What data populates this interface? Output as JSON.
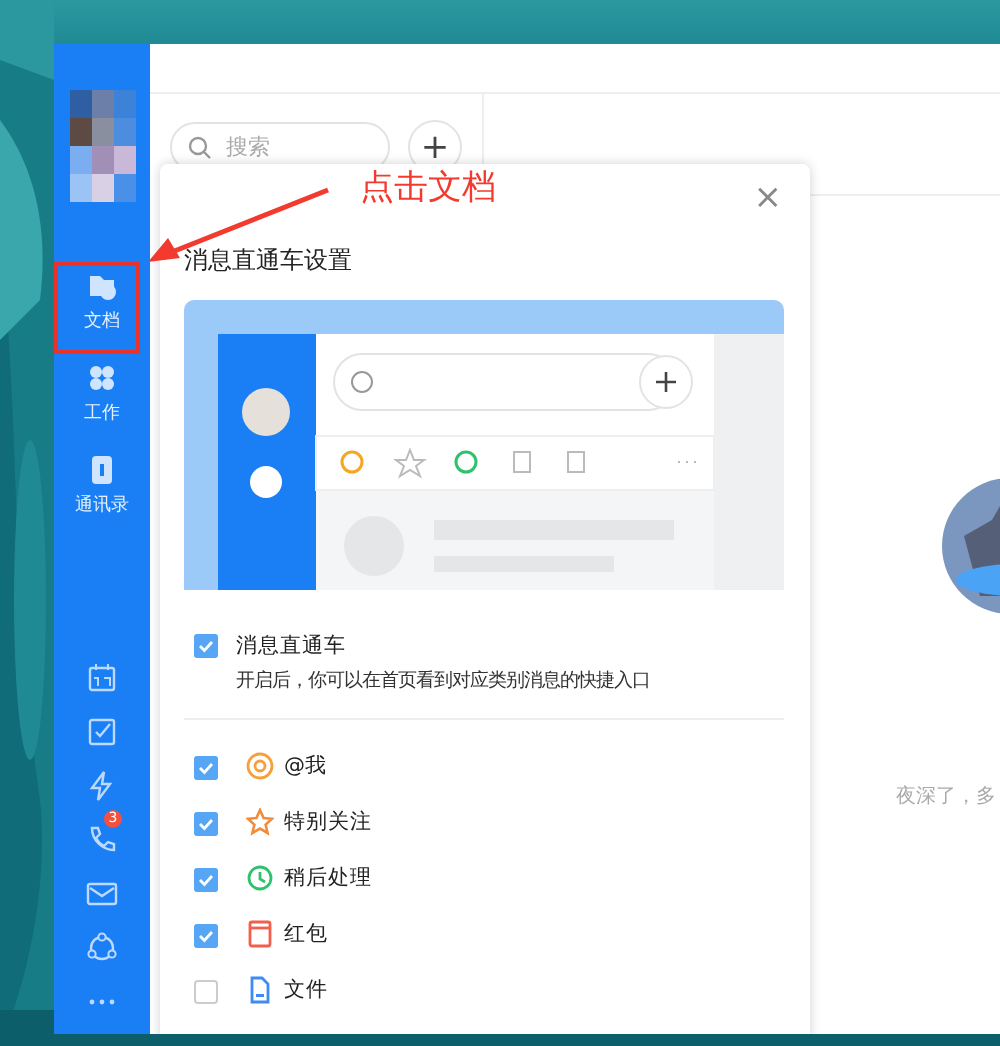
{
  "annotation": {
    "text": "点击文档"
  },
  "sidebar": {
    "items": [
      {
        "kind": "docs",
        "label": "文档"
      },
      {
        "kind": "work",
        "label": "工作"
      },
      {
        "kind": "contacts",
        "label": "通讯录"
      }
    ],
    "tools": [
      {
        "kind": "calendar"
      },
      {
        "kind": "todo"
      },
      {
        "kind": "ding"
      },
      {
        "kind": "phone",
        "badge": "3"
      },
      {
        "kind": "mail"
      },
      {
        "kind": "network"
      },
      {
        "kind": "more"
      }
    ]
  },
  "search": {
    "placeholder": "搜索"
  },
  "add_button": {
    "label": "+"
  },
  "dialog": {
    "title": "消息直通车设置",
    "close": "×",
    "master": {
      "label": "消息直通车",
      "checked": true,
      "description": "开启后，你可以在首页看到对应类别消息的快捷入口"
    },
    "options": [
      {
        "kind": "at",
        "label": "@我",
        "checked": true
      },
      {
        "kind": "star",
        "label": "特别关注",
        "checked": true
      },
      {
        "kind": "later",
        "label": "稍后处理",
        "checked": true
      },
      {
        "kind": "redpacket",
        "label": "红包",
        "checked": true
      },
      {
        "kind": "file",
        "label": "文件",
        "checked": false
      }
    ]
  },
  "main": {
    "greeting": "夜深了，多"
  }
}
